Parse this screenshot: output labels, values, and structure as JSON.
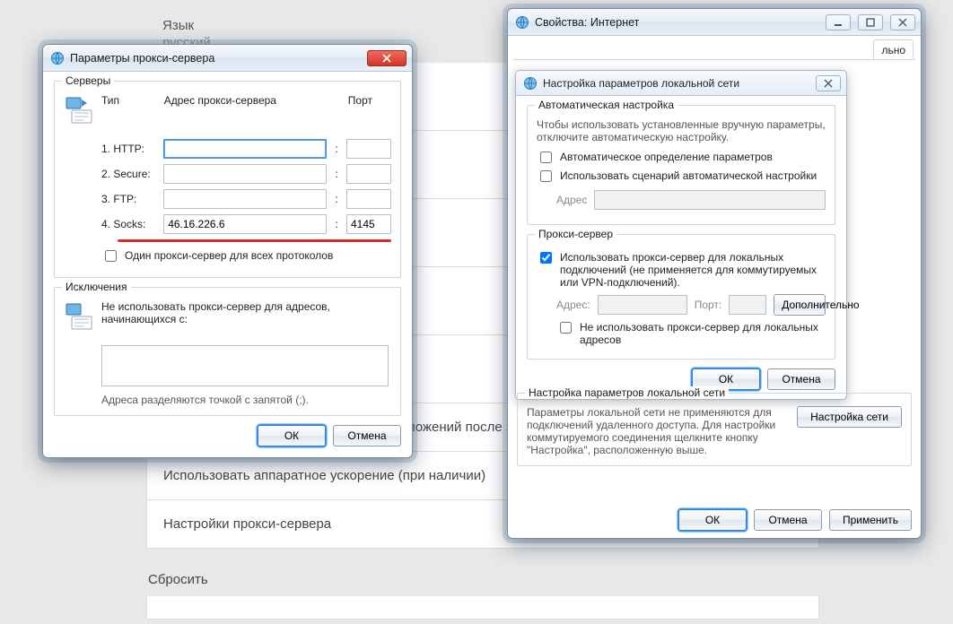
{
  "background": {
    "lang_label": "Язык",
    "lang_value": "русский",
    "row_continue": "Продолжить выполнение фоновых приложений после закрыти",
    "row_hwaccel": "Использовать аппаратное ускорение (при наличии)",
    "row_proxy": "Настройки прокси-сервера",
    "section_reset": "Сбросить"
  },
  "proxy_dialog": {
    "title": "Параметры прокси-сервера",
    "group_servers": "Серверы",
    "col_type": "Тип",
    "col_addr": "Адрес прокси-сервера",
    "col_port": "Порт",
    "rows": {
      "http": {
        "label": "1. HTTP:",
        "addr": "",
        "port": ""
      },
      "secure": {
        "label": "2. Secure:",
        "addr": "",
        "port": ""
      },
      "ftp": {
        "label": "3. FTP:",
        "addr": "",
        "port": ""
      },
      "socks": {
        "label": "4. Socks:",
        "addr": "46.16.226.6",
        "port": "4145"
      }
    },
    "one_for_all": "Один прокси-сервер для всех протоколов",
    "group_exceptions": "Исключения",
    "except_text": "Не использовать прокси-сервер для адресов, начинающихся с:",
    "except_hint": "Адреса разделяются точкой с запятой (;).",
    "ok": "ОК",
    "cancel": "Отмена"
  },
  "inet_dialog": {
    "title": "Свойства: Интернет",
    "tab_partial_right": "льно",
    "lan_dialog": {
      "title": "Настройка параметров локальной сети",
      "group_auto": "Автоматическая настройка",
      "auto_note": "Чтобы использовать установленные вручную параметры, отключите автоматическую настройку.",
      "auto_detect": "Автоматическое определение параметров",
      "use_script": "Использовать сценарий автоматической настройки",
      "addr_label": "Адрес",
      "group_proxy": "Прокси-сервер",
      "use_proxy": "Использовать прокси-сервер для локальных подключений (не применяется для коммутируемых или VPN-подключений).",
      "addr2": "Адрес:",
      "port2": "Порт:",
      "advanced": "Дополнительно",
      "bypass_local": "Не использовать прокси-сервер для локальных адресов",
      "ok": "ОК",
      "cancel": "Отмена"
    },
    "lan_section_title": "Настройка параметров локальной сети",
    "lan_section_text": "Параметры локальной сети не применяются для подключений удаленного доступа. Для настройки коммутируемого соединения щелкните кнопку \"Настройка\", расположенную выше.",
    "lan_settings_btn": "Настройка сети",
    "ok": "ОК",
    "cancel": "Отмена",
    "apply": "Применить"
  }
}
